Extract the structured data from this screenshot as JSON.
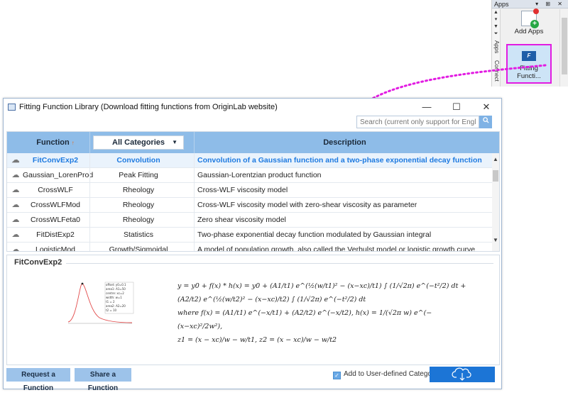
{
  "apps_panel": {
    "title": "Apps",
    "header_icons": "▾ ⊞ ✕",
    "side_tabs": [
      "Apps",
      "Connect"
    ],
    "add_apps_label": "Add Apps",
    "fitting_app_label_line1": "Fitting",
    "fitting_app_label_line2": "Functi..."
  },
  "window": {
    "title": "Fitting Function Library (Download fitting functions from OriginLab website)",
    "minimize": "—",
    "maximize": "☐",
    "close": "✕"
  },
  "search": {
    "placeholder": "Search (current only support for English)...",
    "button_icon": "search-icon"
  },
  "grid": {
    "header_function": "Function",
    "sort_indicator": "↑",
    "category_select": "All Categories",
    "header_description": "Description",
    "rows": [
      {
        "name": "FitConvExp2",
        "category": "Convolution",
        "description": "Convolution of a Gaussian function and a two-phase exponential decay function"
      },
      {
        "name": "Gaussian_LorenProd",
        "category": "Peak Fitting",
        "description": "Gaussian-Lorentzian product function"
      },
      {
        "name": "CrossWLF",
        "category": "Rheology",
        "description": "Cross-WLF viscosity model"
      },
      {
        "name": "CrossWLFMod",
        "category": "Rheology",
        "description": "Cross-WLF viscosity model with zero-shear viscosity as parameter"
      },
      {
        "name": "CrossWLFeta0",
        "category": "Rheology",
        "description": "Zero shear viscosity model"
      },
      {
        "name": "FitDistExp2",
        "category": "Statistics",
        "description": "Two-phase exponential decay function modulated by Gaussian integral"
      },
      {
        "name": "LogisticMod",
        "category": "Growth/Sigmoidal",
        "description": "A model of population growth, also called the Verhulst model or logistic growth curve"
      }
    ]
  },
  "detail": {
    "title": "FitConvExp2",
    "preview_params": [
      "offset: y0=0.1",
      "area1: A1=50",
      "centre: xc=2",
      "width: w=1",
      "t1 = 2",
      "area2: A2=20",
      "t2 = 10"
    ],
    "formula_line1": "y = y0 + f(x) * h(x) = y0 + (A1/t1) e^(½(w/t1)² − (x−xc)/t1) ∫ (1/√2π) e^(−t²/2) dt + (A2/t2) e^(½(w/t2)² − (x−xc)/t2) ∫ (1/√2π) e^(−t²/2) dt",
    "formula_line2": "where f(x) = (A1/t1) e^(−x/t1) + (A2/t2) e^(−x/t2),  h(x) = 1/(√2π w) e^(−(x−xc)²/2w²),",
    "formula_line3": "z1 = (x − xc)/w − w/t1,  z2 = (x − xc)/w − w/t2"
  },
  "footer": {
    "request_button": "Request a Function",
    "share_button": "Share a Function",
    "checkbox_label": "Add to User-defined Category",
    "checkbox_checked": true,
    "download_icon": "cloud-download-icon"
  },
  "colors": {
    "accent": "#1c75d6",
    "header": "#8ebce8",
    "highlight": "#e21ce2",
    "selected_text": "#1e7ae0"
  }
}
